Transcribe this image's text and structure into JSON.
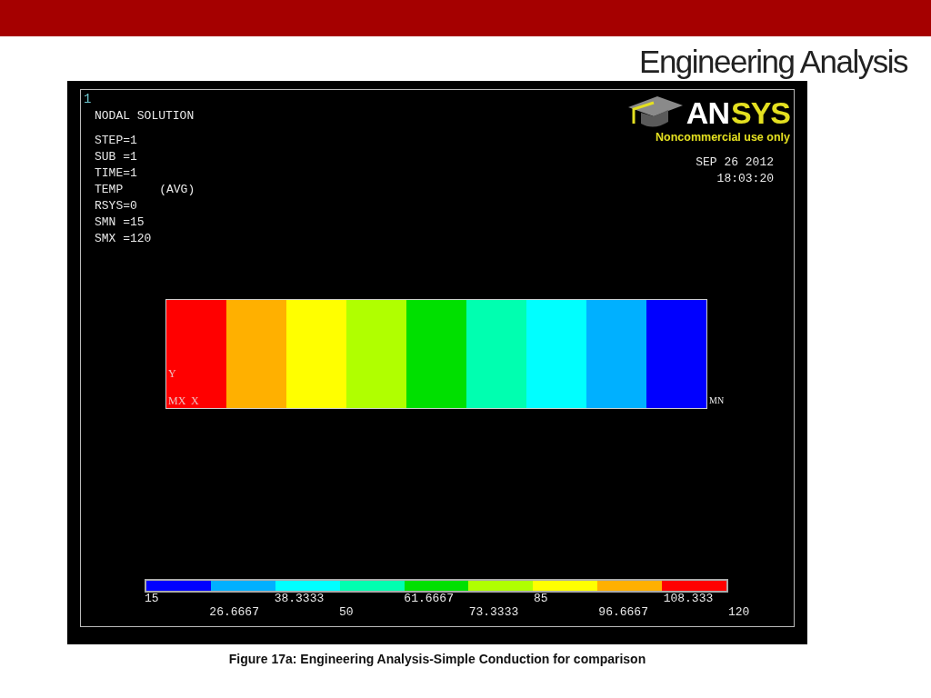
{
  "slide_title": "Engineering Analysis",
  "plot": {
    "viewport_number": "1",
    "title": "NODAL SOLUTION",
    "info_lines": [
      {
        "key": "STEP=1"
      },
      {
        "key": "SUB =1"
      },
      {
        "key": "TIME=1"
      },
      {
        "key": "TEMP",
        "value": "(AVG)"
      },
      {
        "key": "RSYS=0"
      },
      {
        "key": "SMN =15"
      },
      {
        "key": "SMX =120"
      }
    ],
    "logo": {
      "wordmark_left": "AN",
      "wordmark_right": "SYS",
      "tagline": "Noncommercial use only"
    },
    "date": "SEP 26 2012",
    "time": "18:03:20",
    "axis_labels": {
      "y": "Y",
      "x": "X",
      "max": "MX",
      "min": "MN"
    },
    "bands": [
      {
        "color": "#ff0000"
      },
      {
        "color": "#ffb000"
      },
      {
        "color": "#ffff00"
      },
      {
        "color": "#b0ff00"
      },
      {
        "color": "#00e000"
      },
      {
        "color": "#00ffb0"
      },
      {
        "color": "#00ffff"
      },
      {
        "color": "#00b0ff"
      },
      {
        "color": "#0000ff"
      }
    ],
    "legend": {
      "colors": [
        {
          "color": "#0000ff"
        },
        {
          "color": "#00b0ff"
        },
        {
          "color": "#00ffff"
        },
        {
          "color": "#00ffb0"
        },
        {
          "color": "#00e000"
        },
        {
          "color": "#b0ff00"
        },
        {
          "color": "#ffff00"
        },
        {
          "color": "#ffb000"
        },
        {
          "color": "#ff0000"
        }
      ],
      "labels": [
        "15",
        "26.6667",
        "38.3333",
        "50",
        "61.6667",
        "73.3333",
        "85",
        "96.6667",
        "108.333",
        "120"
      ]
    }
  },
  "caption": "Figure 17a: Engineering Analysis-Simple Conduction for comparison"
}
